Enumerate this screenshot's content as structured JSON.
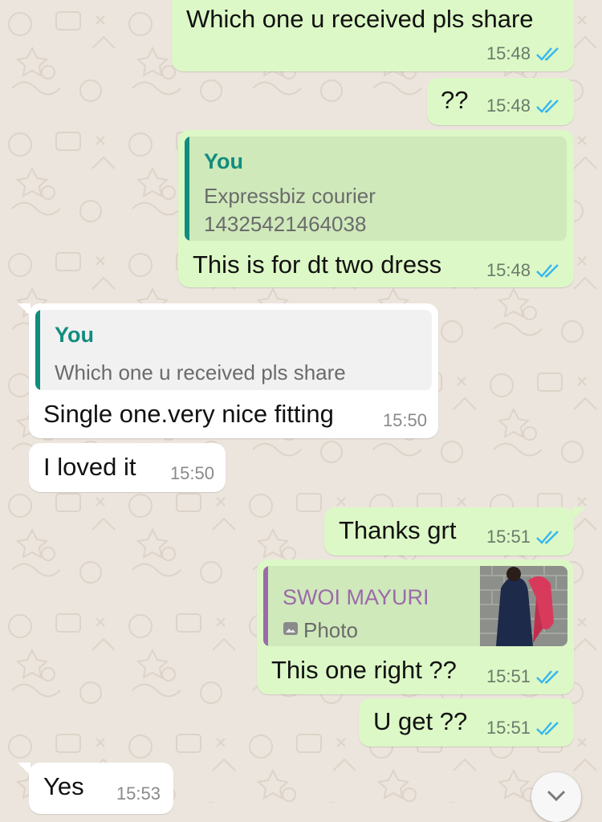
{
  "colors": {
    "background": "#ece5dd",
    "outgoing_bubble": "#dcf8c6",
    "incoming_bubble": "#ffffff",
    "quote_self_accent": "#128c7e",
    "quote_other_accent": "#9b6aa8",
    "read_tick": "#34b7f1"
  },
  "messages": [
    {
      "text": "Which one u received pls share",
      "time": "15:48"
    },
    {
      "text": "??",
      "time": "15:48"
    },
    {
      "quote_author": "You",
      "quote_line1": "Expressbiz courier",
      "quote_line2": "14325421464038",
      "text": "This is for dt two dress",
      "time": "15:48"
    },
    {
      "quote_author": "You",
      "quote_line1": "Which one u received pls share",
      "text": "Single one.very nice fitting",
      "time": "15:50"
    },
    {
      "text": "I loved it",
      "time": "15:50"
    },
    {
      "text": "Thanks grt",
      "time": "15:51"
    },
    {
      "quote_author": "SWOI MAYURI",
      "quote_line1": "Photo",
      "quote_icon": "camera-icon",
      "text": "This one right ??",
      "time": "15:51"
    },
    {
      "text": "U get ??",
      "time": "15:51"
    },
    {
      "text": "Yes",
      "time": "15:53"
    }
  ],
  "scroll_icon": "chevron-down-icon"
}
